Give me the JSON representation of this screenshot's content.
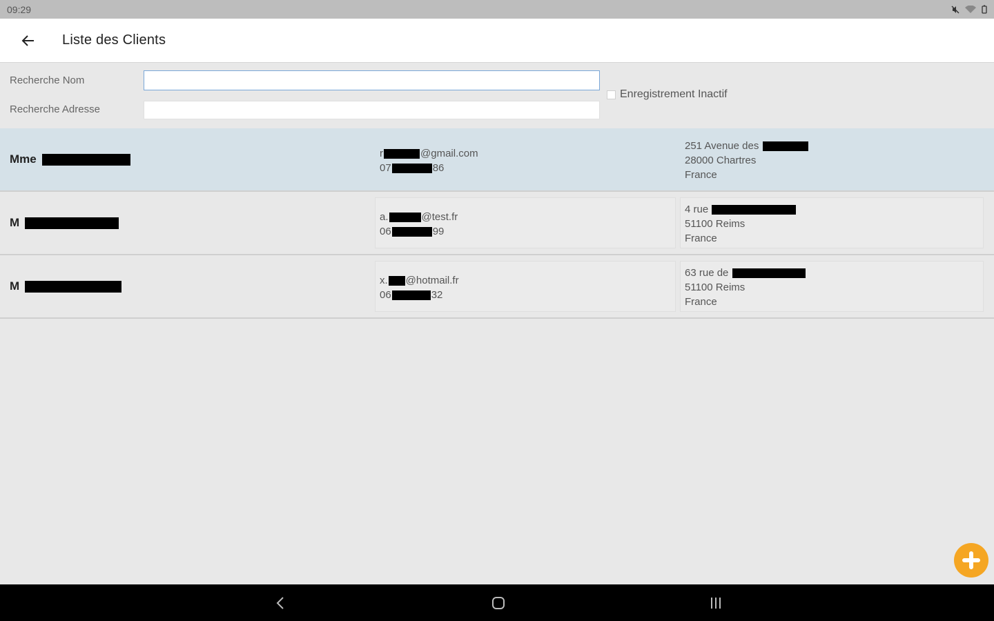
{
  "status_bar": {
    "time": "09:29"
  },
  "app_bar": {
    "title": "Liste des Clients"
  },
  "search": {
    "name_label": "Recherche Nom",
    "name_value": "",
    "address_label": "Recherche Adresse",
    "address_value": "",
    "inactive_label": "Enregistrement Inactif",
    "inactive_checked": false
  },
  "clients": [
    {
      "title": "Mme",
      "email_pre": "r",
      "email_post": "@gmail.com",
      "phone_pre": "07",
      "phone_post": "86",
      "address_street": "251 Avenue des",
      "address_city": "28000 Chartres",
      "address_country": "France",
      "selected": true
    },
    {
      "title": "M",
      "email_pre": "a.",
      "email_post": "@test.fr",
      "phone_pre": "06",
      "phone_post": "99",
      "address_street": "4 rue",
      "address_city": "51100 Reims",
      "address_country": "France",
      "selected": false
    },
    {
      "title": "M",
      "email_pre": "x.",
      "email_post": "@hotmail.fr",
      "phone_pre": "06",
      "phone_post": "32",
      "address_street": "63 rue de",
      "address_city": "51100 Reims",
      "address_country": "France",
      "selected": false
    }
  ],
  "colors": {
    "fab": "#f5a623",
    "selected_row": "#d5e1e8",
    "app_bar": "#ffffff",
    "status_bar": "#bdbdbd",
    "nav_bar": "#000000"
  },
  "icons": {
    "back": "arrow-left-icon",
    "fab": "plus-icon",
    "nav_back": "chevron-left-icon",
    "nav_home": "home-icon",
    "nav_recents": "recents-icon"
  }
}
